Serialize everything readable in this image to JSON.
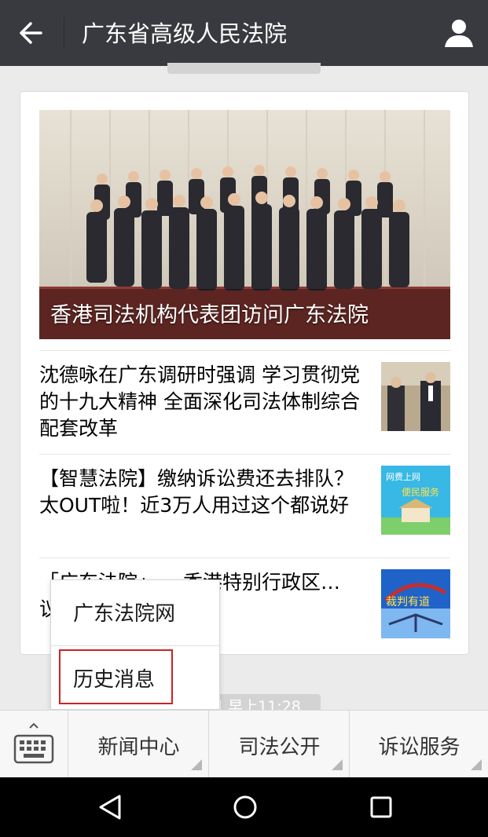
{
  "header": {
    "title": "广东省高级人民法院",
    "back_icon": "arrow-left-icon",
    "profile_icon": "person-icon",
    "background": "#393a3f"
  },
  "article_card": {
    "cover": {
      "title": "香港司法机构代表团访问广东法院"
    },
    "items": [
      {
        "title": "沈德咏在广东调研时强调 学习贯彻党的十九大精神 全面深化司法体制综合配套改革"
      },
      {
        "title": "【智慧法院】缴纳诉讼费还去排队？太OUT啦！近3万人用过这个都说好",
        "thumb_text": [
          "网费上网",
          "便民服务"
        ]
      },
      {
        "title": "「广东法院」… 香港特别行政区… 议",
        "thumb_text": "裁判有道"
      }
    ]
  },
  "timestamp_bottom": "日 早上11:28",
  "popup_menu": {
    "items": [
      {
        "label": "广东法院网"
      },
      {
        "label": "历史消息"
      }
    ],
    "highlight_color": "#cc2222"
  },
  "menubar": {
    "keyboard_icon": "keyboard-icon",
    "buttons": [
      {
        "label": "新闻中心"
      },
      {
        "label": "司法公开"
      },
      {
        "label": "诉讼服务"
      }
    ]
  },
  "navbar": {
    "back_icon": "triangle-back-icon",
    "home_icon": "circle-home-icon",
    "recents_icon": "square-recents-icon"
  }
}
